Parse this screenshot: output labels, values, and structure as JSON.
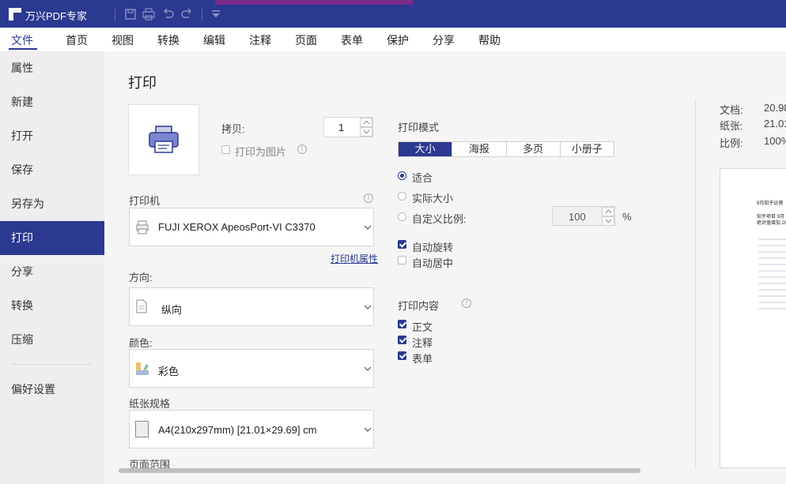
{
  "titlebar": {
    "app_name": "万兴PDF专家"
  },
  "menu": [
    "文件",
    "首页",
    "视图",
    "转换",
    "编辑",
    "注释",
    "页面",
    "表单",
    "保护",
    "分享",
    "帮助"
  ],
  "sidebar": [
    "属性",
    "新建",
    "打开",
    "保存",
    "另存为",
    "打印",
    "分享",
    "转换",
    "压缩",
    "偏好设置"
  ],
  "print": {
    "title": "打印",
    "copies_label": "拷贝:",
    "copies_value": "1",
    "print_as_image": "打印为图片",
    "printer_label": "打印机",
    "printer_value": "FUJI XEROX ApeosPort-VI C3370",
    "printer_properties": "打印机属性",
    "orientation_label": "方向:",
    "orientation_value": "纵向",
    "color_label": "颜色:",
    "color_value": "彩色",
    "paper_label": "纸张规格",
    "paper_value": "A4(210x297mm) [21.01×29.69] cm",
    "page_range_label": "页面范围",
    "mode_label": "打印模式",
    "mode_tabs": [
      "大小",
      "海报",
      "多页",
      "小册子"
    ],
    "fit": "适合",
    "actual_size": "实际大小",
    "custom_scale": "自定义比例:",
    "scale_value": "100",
    "percent": "%",
    "auto_rotate": "自动旋转",
    "auto_center": "自动居中",
    "content_label": "打印内容",
    "content_items": [
      "正文",
      "注释",
      "表单"
    ]
  },
  "preview": {
    "doc_label": "文档:",
    "doc_value": "20.98",
    "paper_label": "纸张:",
    "paper_value": "21.01",
    "scale_label": "比例:",
    "scale_value": "100%",
    "page_lines": [
      "9月知乎运营",
      "知乎项目 9月",
      "绝对值增加 20"
    ]
  },
  "colors": {
    "accent": "#2b3990"
  }
}
